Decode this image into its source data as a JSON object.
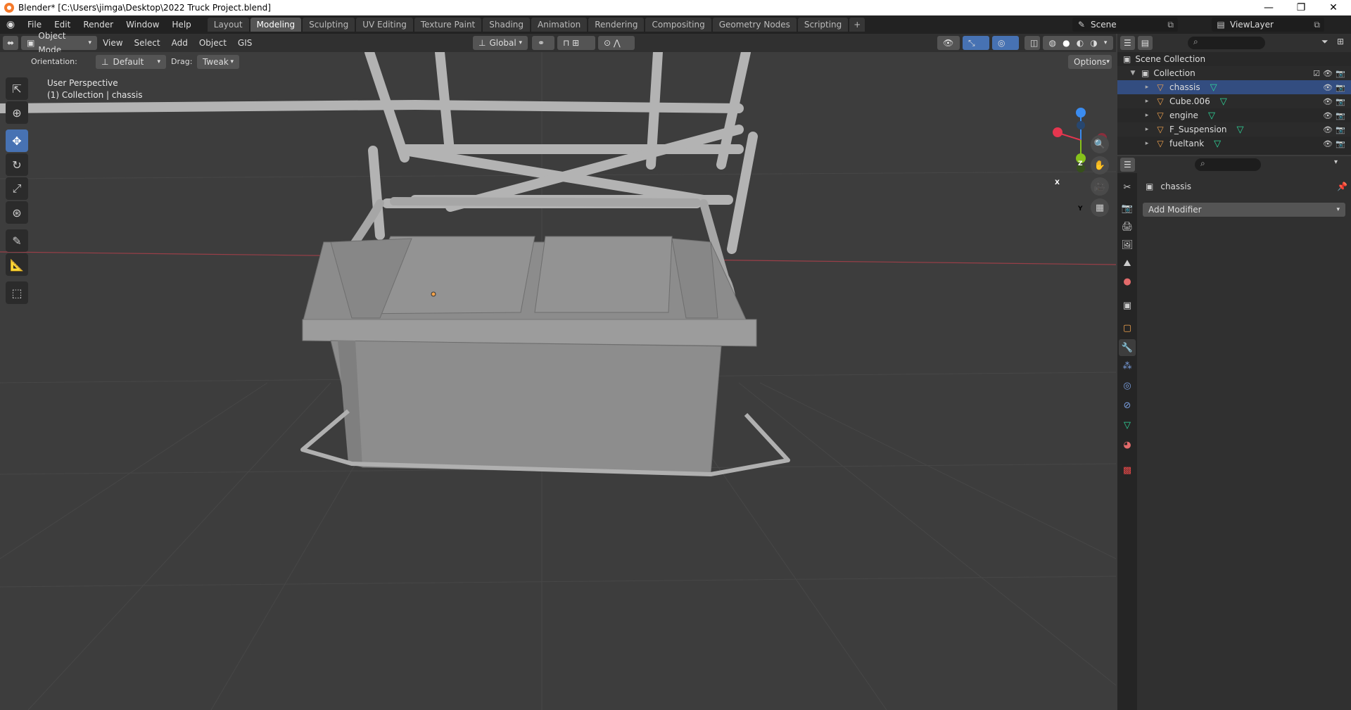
{
  "window": {
    "title": "Blender* [C:\\Users\\jimga\\Desktop\\2022 Truck Project.blend]",
    "controls": [
      "—",
      "❐",
      "✕"
    ]
  },
  "menubar": {
    "items": [
      "File",
      "Edit",
      "Render",
      "Window",
      "Help"
    ],
    "tabs": [
      "Layout",
      "Modeling",
      "Sculpting",
      "UV Editing",
      "Texture Paint",
      "Shading",
      "Animation",
      "Rendering",
      "Compositing",
      "Geometry Nodes",
      "Scripting"
    ],
    "active_tab": "Modeling",
    "add_tab": "+",
    "scene": "Scene",
    "view_layer": "ViewLayer"
  },
  "header": {
    "mode": "Object Mode",
    "menus": [
      "View",
      "Select",
      "Add",
      "Object",
      "GIS"
    ],
    "transform_orientation": "Global"
  },
  "tool_settings": {
    "orientation_label": "Orientation:",
    "orientation_value": "Default",
    "drag_label": "Drag:",
    "drag_value": "Tweak",
    "options_label": "Options"
  },
  "viewport": {
    "view_name": "User Perspective",
    "context": "(1) Collection | chassis",
    "gizmo_axes": [
      "X",
      "Y",
      "Z"
    ]
  },
  "toolbar": {
    "tools": [
      "select-box",
      "cursor",
      "move",
      "rotate",
      "scale",
      "transform",
      "annotate",
      "measure",
      "add-cube"
    ],
    "active": "move"
  },
  "outliner": {
    "root": "Scene Collection",
    "collection": "Collection",
    "objects": [
      "chassis",
      "Cube.006",
      "engine",
      "F_Suspension",
      "fueltank"
    ]
  },
  "properties": {
    "object_name": "chassis",
    "add_modifier_label": "Add Modifier"
  },
  "colors": {
    "accent": "#4772b3",
    "mesh_icon": "#f0a24e",
    "data_icon": "#2fd79b",
    "axis_x": "#e5364f",
    "axis_y": "#86c21b",
    "axis_z": "#3b8cf0"
  }
}
